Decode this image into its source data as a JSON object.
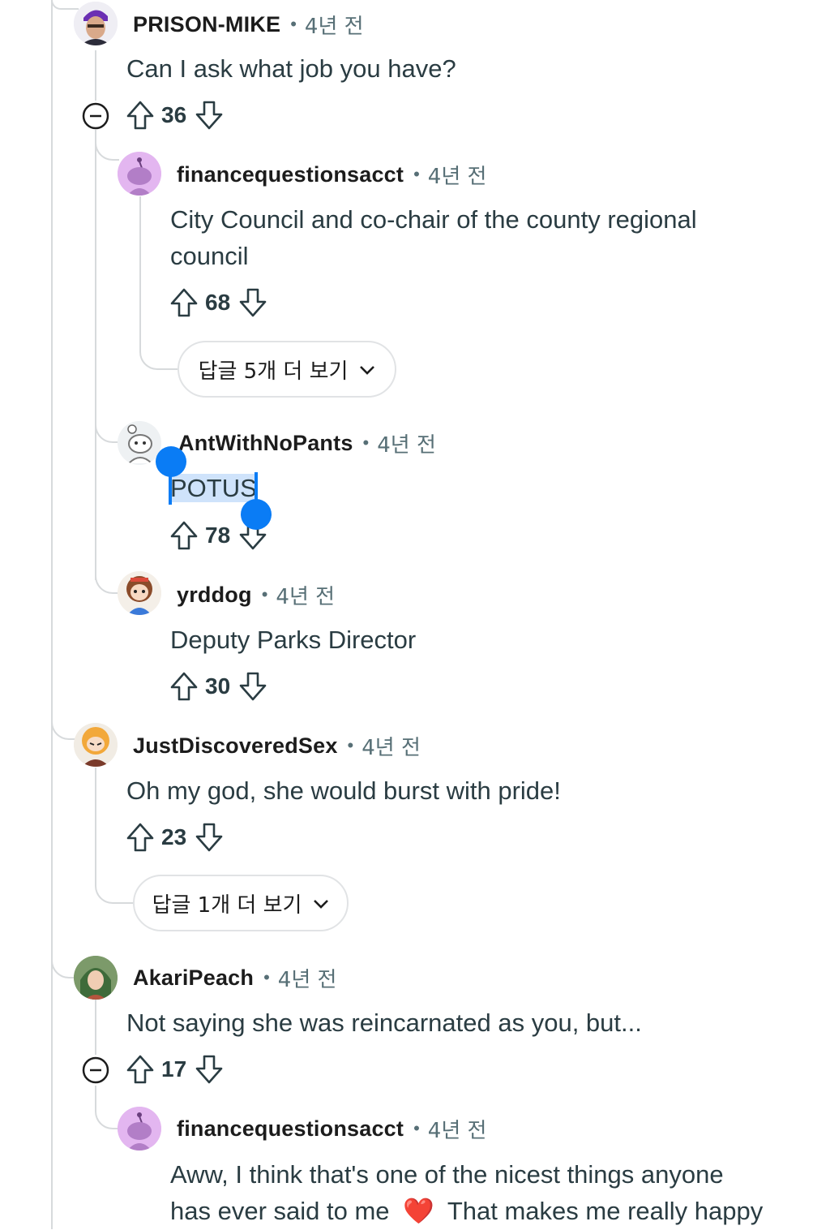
{
  "comments": [
    {
      "username": "PRISON-MIKE",
      "time": "4년 전",
      "body": "Can I ask what job you have?",
      "score": "36"
    },
    {
      "username": "financequestionsacct",
      "time": "4년 전",
      "body_lines": [
        "City Council and co-chair of the county regional",
        "council"
      ],
      "score": "68"
    },
    {
      "username": "AntWithNoPants",
      "time": "4년 전",
      "body": "POTUS",
      "score": "78"
    },
    {
      "username": "yrddog",
      "time": "4년 전",
      "body": "Deputy Parks Director",
      "score": "30"
    },
    {
      "username": "JustDiscoveredSex",
      "time": "4년 전",
      "body": "Oh my god, she would burst with pride!",
      "score": "23"
    },
    {
      "username": "AkariPeach",
      "time": "4년 전",
      "body": "Not saying she was reincarnated as you, but...",
      "score": "17"
    },
    {
      "username": "financequestionsacct",
      "time": "4년 전",
      "body_lines": [
        "Aww, I think that's one of the nicest things anyone",
        "has ever said to me",
        "That makes me really happy"
      ],
      "emoji": "❤️"
    }
  ],
  "more_replies": [
    {
      "label": "답글 5개 더 보기"
    },
    {
      "label": "답글 1개 더 보기"
    }
  ],
  "meta_separator": "•",
  "icons": {
    "upvote": "arrow-up-outline",
    "downvote": "arrow-down-outline",
    "collapse": "minus-circle",
    "expand": "chevron-down",
    "heart": "heart-emoji"
  },
  "colors": {
    "selection": "#cfe3fb",
    "handle": "#0a7cf5",
    "thread_line": "#d7dadc",
    "text": "#2a3c42",
    "muted": "#576f76"
  }
}
